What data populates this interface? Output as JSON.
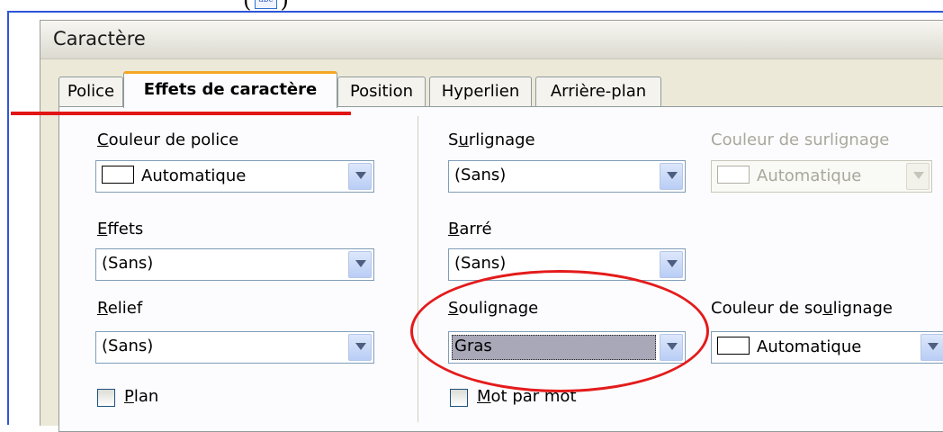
{
  "window": {
    "title": "Caractère"
  },
  "tabs": [
    {
      "label": "Police"
    },
    {
      "label": "Effets de caractère"
    },
    {
      "label": "Position"
    },
    {
      "label": "Hyperlien"
    },
    {
      "label": "Arrière-plan"
    }
  ],
  "fields": {
    "font_color": {
      "label": "Couleur de police",
      "value": "Automatique"
    },
    "effects": {
      "label": "Effets",
      "value": "(Sans)"
    },
    "relief": {
      "label": "Relief",
      "value": "(Sans)"
    },
    "outline": {
      "label": "Plan"
    },
    "highlight": {
      "label": "Surlignage",
      "value": "(Sans)"
    },
    "highlight_color": {
      "label": "Couleur de surlignage",
      "value": "Automatique"
    },
    "strikethrough": {
      "label": "Barré",
      "value": "(Sans)"
    },
    "underline": {
      "label": "Soulignage",
      "value": "Gras"
    },
    "underline_color": {
      "label": "Couleur de soulignage",
      "value": "Automatique"
    },
    "word_by_word": {
      "label": "Mot par mot"
    }
  },
  "colors": {
    "annotation": "#e21515",
    "frame": "#2f56d8",
    "active_tab_accent": "#f5a623"
  }
}
